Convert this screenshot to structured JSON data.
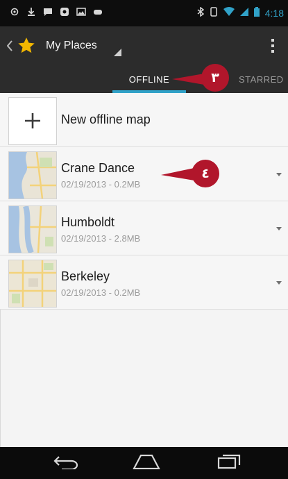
{
  "status_bar": {
    "time": "4:18"
  },
  "action_bar": {
    "title": "My Places"
  },
  "tabs": [
    {
      "label": "OFFLINE",
      "selected": true
    },
    {
      "label": "STARRED",
      "selected": false
    }
  ],
  "new_map": {
    "label": "New offline map"
  },
  "maps": [
    {
      "name": "Crane Dance",
      "meta": "02/19/2013 - 0.2MB"
    },
    {
      "name": "Humboldt",
      "meta": "02/19/2013 - 2.8MB"
    },
    {
      "name": "Berkeley",
      "meta": "02/19/2013 - 0.2MB"
    }
  ],
  "annotations": {
    "tab_marker": "٣",
    "item_marker": "٤"
  },
  "colors": {
    "accent": "#31a2c8",
    "marker": "#b1162b",
    "star": "#f3b700"
  }
}
